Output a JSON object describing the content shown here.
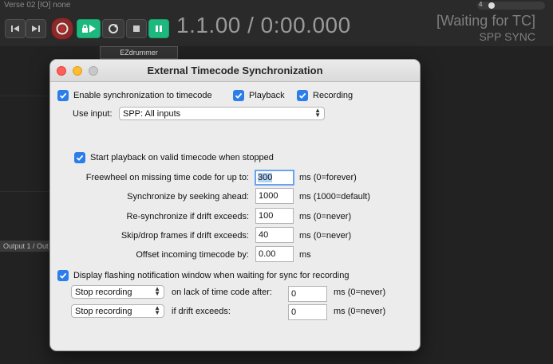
{
  "daw": {
    "track_title": "Verse 02 [IO] none",
    "time_display": "1.1.00 / 0:00.000",
    "tc_status": "[Waiting for TC]",
    "tc_mode": "SPP SYNC",
    "fx_tab": "EZdrummer",
    "output_tab": "Output 1 / Out",
    "tcp_number": "4"
  },
  "dialog": {
    "title": "External Timecode Synchronization",
    "enable_sync_label": "Enable synchronization to timecode",
    "playback_label": "Playback",
    "recording_label": "Recording",
    "use_input_label": "Use input:",
    "use_input_value": "SPP: All inputs",
    "start_playback_label": "Start playback on valid timecode when stopped",
    "fields": [
      {
        "label": "Freewheel on missing time code for up to:",
        "value": "300",
        "unit": "ms (0=forever)"
      },
      {
        "label": "Synchronize by seeking ahead:",
        "value": "1000",
        "unit": "ms (1000=default)"
      },
      {
        "label": "Re-synchronize if drift exceeds:",
        "value": "100",
        "unit": "ms (0=never)"
      },
      {
        "label": "Skip/drop frames if drift exceeds:",
        "value": "40",
        "unit": "ms (0=never)"
      },
      {
        "label": "Offset incoming timecode by:",
        "value": "0.00",
        "unit": "ms"
      }
    ],
    "flash_label": "Display flashing notification window when waiting for sync for recording",
    "lack_action": "Stop recording",
    "lack_label": "on lack of time code after:",
    "lack_value": "0",
    "lack_unit": "ms (0=never)",
    "drift_action": "Stop recording",
    "drift_label": "if drift exceeds:",
    "drift_value": "0",
    "drift_unit": "ms (0=never)"
  },
  "colors": {
    "accent": "#2b7de9",
    "transport_green": "#1db87d",
    "record_red": "#8a2a2a"
  }
}
